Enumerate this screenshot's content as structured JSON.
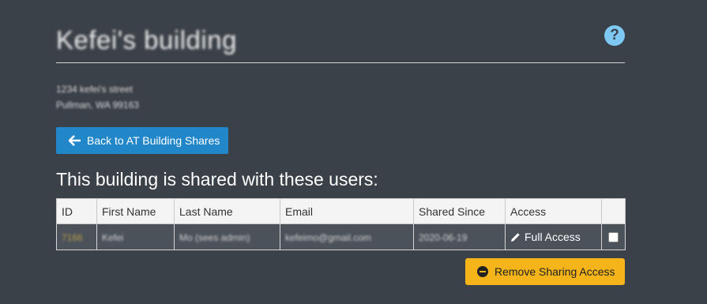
{
  "header": {
    "title": "Kefei's building",
    "help_icon": "question-circle-icon"
  },
  "address": {
    "line1": "1234 kefei's street",
    "line2": "Pullman, WA 99163"
  },
  "back_button": {
    "label": "Back to AT Building Shares",
    "icon": "arrow-left-icon"
  },
  "section_heading": "This building is shared with these users:",
  "table": {
    "columns": [
      "ID",
      "First Name",
      "Last Name",
      "Email",
      "Shared Since",
      "Access",
      ""
    ],
    "rows": [
      {
        "id": "7166",
        "first_name": "Kefei",
        "last_name": "Mo (sees admin)",
        "email": "kefeimo@gmail.com",
        "shared_since": "2020-06-19",
        "access": "Full Access",
        "access_icon": "pencil-icon"
      }
    ]
  },
  "remove_button": {
    "label": "Remove Sharing Access",
    "icon": "minus-circle-icon"
  },
  "colors": {
    "background": "#3b4148",
    "primary_button": "#2187c9",
    "warning_button": "#f5b419",
    "help_icon": "#7ec8f4"
  }
}
